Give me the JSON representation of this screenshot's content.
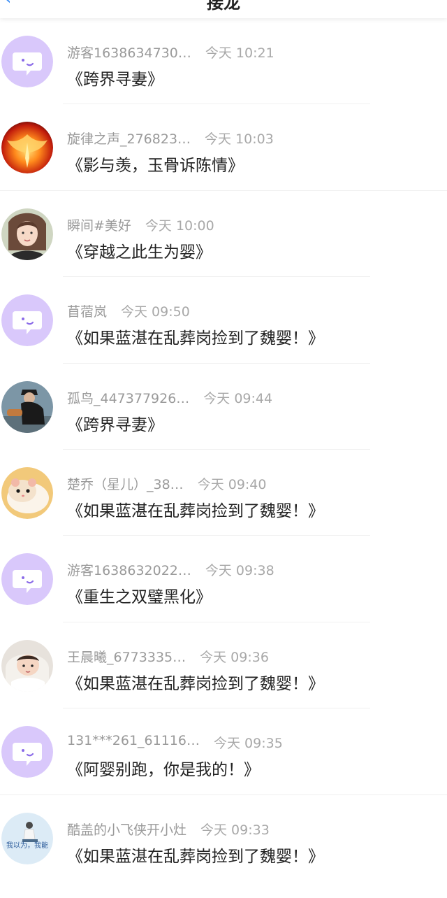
{
  "header": {
    "title": "接龙",
    "back_label": "‹"
  },
  "rows": [
    {
      "name": "游客1638634730…",
      "time": "今天 10:21",
      "message": "《跨界寻妻》",
      "avatar": "chat-bubble"
    },
    {
      "name": "旋律之声_276823…",
      "time": "今天 10:03",
      "message": "《影与羡，玉骨诉陈情》",
      "avatar": "phoenix"
    },
    {
      "name": "瞬间#美好",
      "time": "今天 10:00",
      "message": "《穿越之此生为婴》",
      "avatar": "woman"
    },
    {
      "name": "苜蓿岚",
      "time": "今天 09:50",
      "message": "《如果蓝湛在乱葬岗捡到了魏婴！》",
      "avatar": "chat-bubble"
    },
    {
      "name": "孤鸟_447377926…",
      "time": "今天 09:44",
      "message": "《跨界寻妻》",
      "avatar": "person-dark"
    },
    {
      "name": "楚乔（星儿）_38…",
      "time": "今天 09:40",
      "message": "《如果蓝湛在乱葬岗捡到了魏婴！》",
      "avatar": "hamster"
    },
    {
      "name": "游客1638632022…",
      "time": "今天 09:38",
      "message": "《重生之双璧黑化》",
      "avatar": "chat-bubble"
    },
    {
      "name": "王晨曦_6773335…",
      "time": "今天 09:36",
      "message": "《如果蓝湛在乱葬岗捡到了魏婴！》",
      "avatar": "baby"
    },
    {
      "name": "131***261_61116…",
      "time": "今天 09:35",
      "message": "《阿婴别跑，你是我的！》",
      "avatar": "chat-bubble"
    },
    {
      "name": "酷盖的小飞侠开小灶",
      "time": "今天 09:33",
      "message": "《如果蓝湛在乱葬岗捡到了魏婴！》",
      "avatar": "text-photo",
      "avatar_text": "我以为，我能"
    }
  ],
  "colors": {
    "accent": "#3a8ef6",
    "bubble_bg": "#d9c8fb",
    "bubble_fg": "#8b6be8"
  }
}
